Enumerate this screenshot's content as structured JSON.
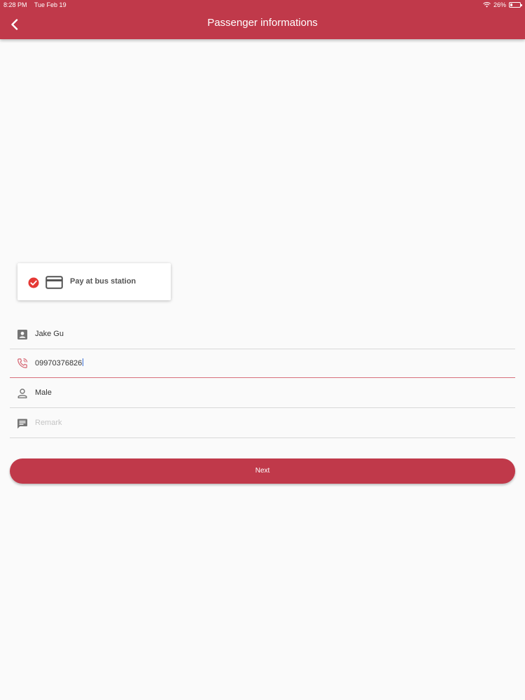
{
  "status_bar": {
    "time": "8:28 PM",
    "date": "Tue Feb 19",
    "battery": "26%",
    "battery_level": 0.26
  },
  "header": {
    "title": "Passenger informations",
    "back_icon": "chevron-left-icon"
  },
  "payment": {
    "label": "Pay at bus station",
    "selected": true,
    "check_icon": "check-circle-icon",
    "card_icon": "credit-card-icon",
    "check_color": "#e53935"
  },
  "form": {
    "name": {
      "value": "Jake Gu",
      "icon": "contact-card-icon"
    },
    "phone": {
      "value": "09970376826",
      "icon": "phone-icon"
    },
    "gender": {
      "value": "Male",
      "icon": "person-icon"
    },
    "remark": {
      "value": "",
      "placeholder": "Remark",
      "icon": "comment-icon"
    }
  },
  "actions": {
    "next_label": "Next"
  },
  "colors": {
    "primary": "#c0394a",
    "focus_underline": "#d86f7b",
    "background": "#fafafa"
  }
}
